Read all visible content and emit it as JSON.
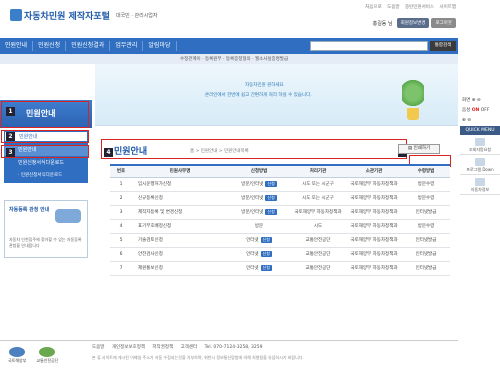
{
  "header": {
    "logo_text": "자동차민원 제작자포털",
    "logo_sub": "대국민 · 관리시업자",
    "top_links": [
      "처음으로",
      "도움말",
      "중탄민원서비스",
      "사이트맵"
    ],
    "user_name": "홍길동 님",
    "btn_info": "회원정보변경",
    "btn_logout": "로그아웃"
  },
  "nav": {
    "items": [
      "민원안내",
      "민원신청",
      "민원신청결과",
      "업무관리",
      "알림마당"
    ],
    "search_button": "통합검색"
  },
  "subnav": {
    "text": "수정관계이 · 등록원부 · 등록증정형의 · 월소사실증명발급"
  },
  "banner": {
    "line1": "자동차민원 원하세요",
    "line2": "온라인에서 한번에 쉽고 간편하게 처리 하실 수 있습니다."
  },
  "sidebar": {
    "title": "민원안내",
    "items": [
      "민원안내",
      "민원안내",
      "민원신청서식다운로드"
    ],
    "sub": "· 민원신청서식다운로드",
    "box_title": "자동등록 관청 안내",
    "box_desc": "자동차 인천집주에 찾아할 수 있는 자동등록관청을 안내합니다"
  },
  "markers": [
    "1",
    "2",
    "3",
    "4",
    "5"
  ],
  "content": {
    "title": "민원안내",
    "breadcrumb": "홈 > 민원안내 > 민원안내목록",
    "print_button": "인쇄하기",
    "columns": [
      "번호",
      "민원사무명",
      "신청방법",
      "처리기관",
      "소관기관",
      "수령방법"
    ],
    "rows": [
      {
        "no": "1",
        "name": "임시운행허가신청",
        "method": "방문/인터넷",
        "badge": "신청",
        "org": "시도 또는 시군구",
        "dept": "국토해양부 자동차정책과",
        "recv": "방문수령"
      },
      {
        "no": "2",
        "name": "신규등록신청",
        "method": "방문/인터넷",
        "badge": "신청",
        "org": "시도 또는 시군구",
        "dept": "국토해양부 자동차정책과",
        "recv": "방문수령"
      },
      {
        "no": "3",
        "name": "제작자등록 및 변경신청",
        "method": "방문/인터넷",
        "badge": "신청",
        "org": "국토해양부 자동차정책과",
        "dept": "국토해양부 자동차정책과",
        "recv": "인터넷발급"
      },
      {
        "no": "4",
        "name": "표기부호배정신청",
        "method": "방문",
        "badge": "",
        "org": "시도",
        "dept": "국토해양부 자동차정책과",
        "recv": "방문수령"
      },
      {
        "no": "5",
        "name": "기술검토신청",
        "method": "인터넷",
        "badge": "신청",
        "org": "교통안전공단",
        "dept": "국토해양부 자동차정책과",
        "recv": "인터넷발급"
      },
      {
        "no": "6",
        "name": "안전검사신청",
        "method": "인터넷",
        "badge": "신청",
        "org": "교통안전공단",
        "dept": "국토해양부 자동차정책과",
        "recv": "인터넷발급"
      },
      {
        "no": "7",
        "name": "제원통보신청",
        "method": "인터넷",
        "badge": "신청",
        "org": "교통안전공단",
        "dept": "국토해양부 자동차정책과",
        "recv": "인터넷발급"
      }
    ]
  },
  "quickbar": {
    "font_label": "화면",
    "sound_label": "음성",
    "on": "ON",
    "off": "OFF",
    "menu": "QUICK MENU",
    "items": [
      "조회자망요청",
      "프로그램 Down",
      "자동차정보"
    ]
  },
  "footer": {
    "logo1": "국토해양부",
    "logo2": "교통안전공단",
    "links": [
      "도움말",
      "개인정보보호정책",
      "저작권정책",
      "고객센터"
    ],
    "tel": "Tel. 070-7124-3258, 3259",
    "copy": "본 류 사이트에 게시된 이메일 주소가 자동 수집되는것을 거부하며, 위반시 정보통신망법에 의해 처벌됨을 유념하시기 바랍니다."
  }
}
